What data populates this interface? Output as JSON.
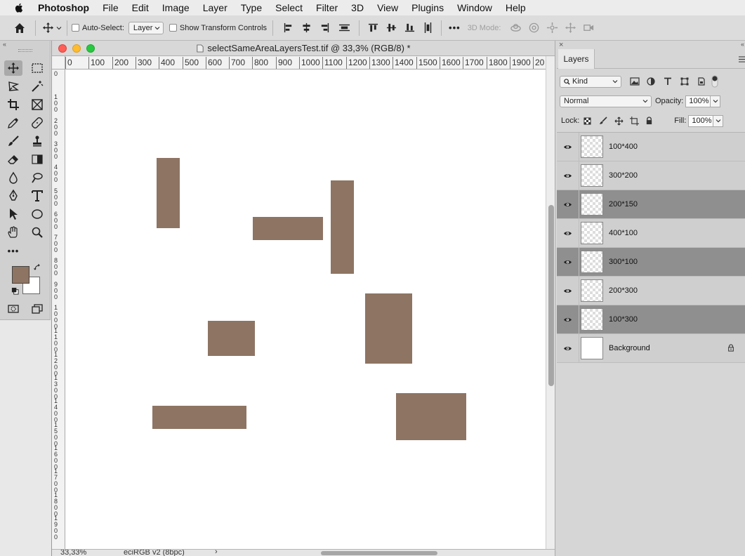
{
  "menubar": {
    "app_name": "Photoshop",
    "items": [
      "File",
      "Edit",
      "Image",
      "Layer",
      "Type",
      "Select",
      "Filter",
      "3D",
      "View",
      "Plugins",
      "Window",
      "Help"
    ]
  },
  "options_bar": {
    "auto_select_label": "Auto-Select:",
    "auto_select_checked": false,
    "auto_select_target": "Layer",
    "transform_controls_label": "Show Transform Controls",
    "transform_controls_checked": false,
    "more_label": "•••",
    "mode_3d_label": "3D Mode:"
  },
  "tools": {
    "icons": [
      "move-icon",
      "marquee-icon",
      "lasso-icon",
      "magic-wand-icon",
      "crop-icon",
      "frame-icon",
      "eyedropper-icon",
      "healing-brush-icon",
      "brush-icon",
      "clone-stamp-icon",
      "eraser-icon",
      "gradient-icon",
      "blur-icon",
      "dodge-icon",
      "pen-icon",
      "type-icon",
      "path-selection-icon",
      "ellipse-icon",
      "hand-icon",
      "zoom-icon"
    ],
    "more_label": "•••",
    "foreground_color": "#8e7463",
    "background_color": "#ffffff"
  },
  "document": {
    "title": "selectSameAreaLayersTest.tif @ 33,3% (RGB/8) *",
    "ruler_top": [
      "0",
      "100",
      "200",
      "300",
      "400",
      "500",
      "600",
      "700",
      "800",
      "900",
      "1000",
      "1100",
      "1200",
      "1300",
      "1400",
      "1500",
      "1600",
      "1700",
      "1800",
      "1900",
      "20"
    ],
    "ruler_left": [
      "0",
      "100",
      "200",
      "300",
      "400",
      "500",
      "600",
      "700",
      "800",
      "900",
      "1000",
      "1100",
      "1200",
      "1300",
      "1400",
      "1500",
      "1600",
      "1700",
      "1800",
      "1900"
    ],
    "shape_color": "#8e7463",
    "zoom": "33,33%",
    "color_profile": "eciRGB v2 (8bpc)"
  },
  "layers_panel": {
    "tab_label": "Layers",
    "filter_kind": "Kind",
    "blend_mode": "Normal",
    "opacity_label": "Opacity:",
    "opacity_value": "100%",
    "lock_label": "Lock:",
    "fill_label": "Fill:",
    "fill_value": "100%",
    "layers": [
      {
        "name": "100*400",
        "visible": true,
        "selected": false
      },
      {
        "name": "300*200",
        "visible": true,
        "selected": false
      },
      {
        "name": "200*150",
        "visible": true,
        "selected": true
      },
      {
        "name": "400*100",
        "visible": true,
        "selected": false
      },
      {
        "name": "300*100",
        "visible": true,
        "selected": true
      },
      {
        "name": "200*300",
        "visible": true,
        "selected": false
      },
      {
        "name": "100*300",
        "visible": true,
        "selected": true
      },
      {
        "name": "Background",
        "visible": true,
        "selected": false,
        "locked": true
      }
    ]
  }
}
